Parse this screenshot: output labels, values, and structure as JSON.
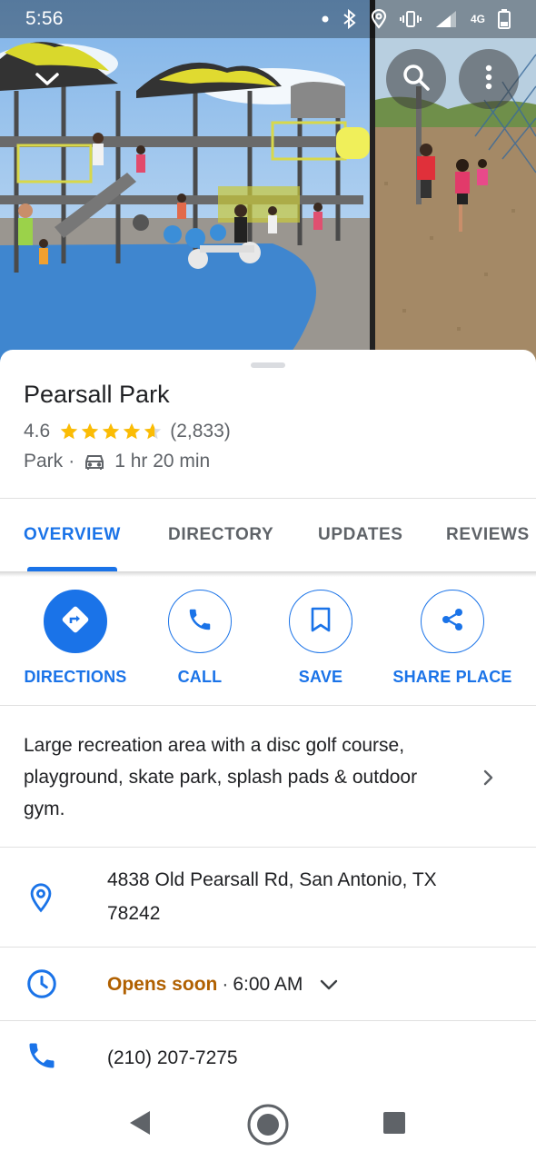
{
  "status_bar": {
    "time": "5:56",
    "network": "4G",
    "battery_level": "18"
  },
  "photo_overlay": {
    "collapse_icon": "chevron-down-icon",
    "search_icon": "search-icon",
    "more_icon": "more-vert-icon"
  },
  "place": {
    "name": "Pearsall Park",
    "rating": "4.6",
    "rating_stars": 4.6,
    "review_count": "(2,833)",
    "category": "Park",
    "separator": "·",
    "travel_mode_icon": "car-icon",
    "travel_time": "1 hr 20 min"
  },
  "tabs": [
    {
      "label": "OVERVIEW",
      "active": true
    },
    {
      "label": "DIRECTORY",
      "active": false
    },
    {
      "label": "UPDATES",
      "active": false
    },
    {
      "label": "REVIEWS",
      "active": false
    }
  ],
  "actions": [
    {
      "label": "DIRECTIONS",
      "icon": "directions-icon"
    },
    {
      "label": "CALL",
      "icon": "phone-icon"
    },
    {
      "label": "SAVE",
      "icon": "bookmark-icon"
    },
    {
      "label": "SHARE PLACE",
      "icon": "share-icon"
    }
  ],
  "description": {
    "text": "Large recreation area with a disc golf course, playground, skate park, splash pads & outdoor gym."
  },
  "address": {
    "line1": "4838 Old Pearsall Rd, San Antonio, TX",
    "line2": "78242"
  },
  "hours": {
    "status": "Opens soon",
    "separator": "·",
    "time": "6:00 AM"
  },
  "phone": {
    "number": "(210) 207-7275"
  },
  "colors": {
    "accent": "#1a73e8",
    "star": "#fbbc04",
    "hours_status": "#b06000"
  }
}
